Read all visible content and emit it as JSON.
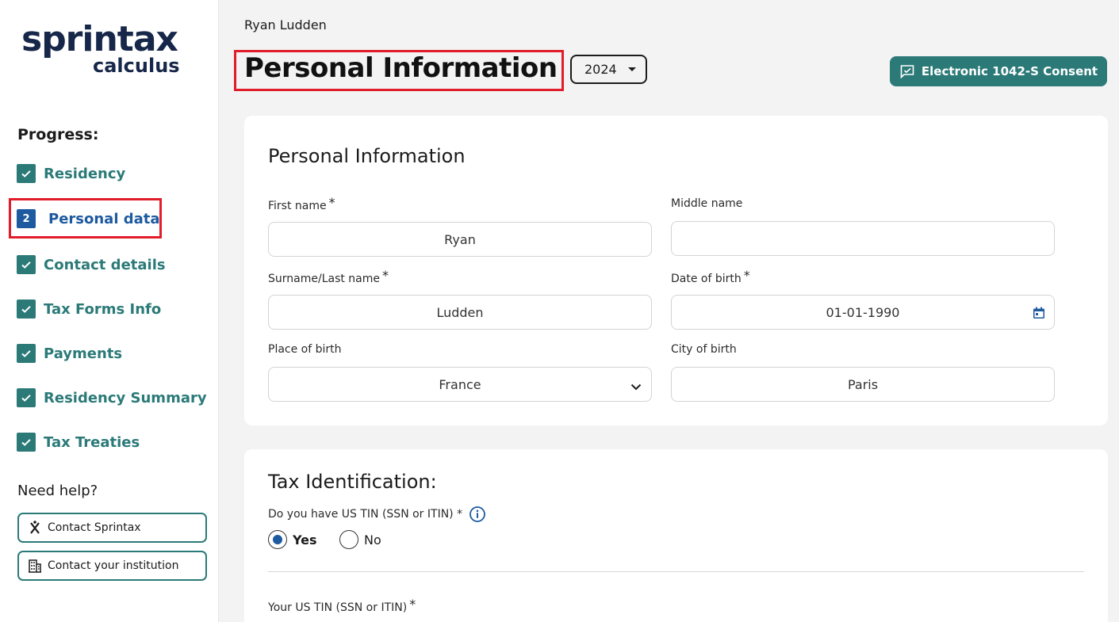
{
  "brand": {
    "name": "sprintax",
    "sub": "calculus"
  },
  "sidebar": {
    "progress_title": "Progress:",
    "steps": [
      {
        "label": "Residency",
        "state": "done"
      },
      {
        "label": "Personal data",
        "state": "active",
        "number": "2"
      },
      {
        "label": "Contact details",
        "state": "done"
      },
      {
        "label": "Tax Forms Info",
        "state": "done"
      },
      {
        "label": "Payments",
        "state": "done"
      },
      {
        "label": "Residency Summary",
        "state": "done"
      },
      {
        "label": "Tax Treaties",
        "state": "done"
      }
    ],
    "help_title": "Need help?",
    "help_buttons": [
      {
        "label": "Contact Sprintax",
        "icon": "sprintax-logo-icon"
      },
      {
        "label": "Contact your institution",
        "icon": "building-icon"
      }
    ]
  },
  "header": {
    "user_name": "Ryan Ludden",
    "page_title": "Personal Information",
    "year": "2024",
    "consent_button": "Electronic 1042-S Consent"
  },
  "personal_info": {
    "title": "Personal Information",
    "first_name": {
      "label": "First name",
      "required": "*",
      "value": "Ryan"
    },
    "middle_name": {
      "label": "Middle name",
      "value": ""
    },
    "last_name": {
      "label": "Surname/Last name",
      "required": "*",
      "value": "Ludden"
    },
    "date_of_birth": {
      "label": "Date of birth",
      "required": "*",
      "value": "01-01-1990"
    },
    "place_of_birth": {
      "label": "Place of birth",
      "value": "France"
    },
    "city_of_birth": {
      "label": "City of birth",
      "value": "Paris"
    }
  },
  "tax_identification": {
    "title": "Tax Identification:",
    "question": "Do you have US TIN (SSN or ITIN) *",
    "options": {
      "yes": "Yes",
      "no": "No"
    },
    "selected": "yes",
    "tin_label": "Your US TIN (SSN or ITIN)",
    "tin_required": "*"
  },
  "colors": {
    "accent": "#2b7a78",
    "active": "#1e5aa0",
    "highlight": "#e21d2b",
    "brand": "#17274a"
  }
}
